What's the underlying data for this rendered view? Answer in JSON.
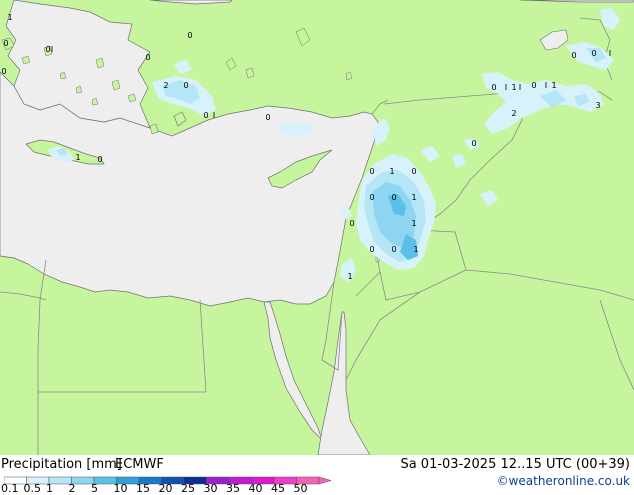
{
  "header": {
    "title": "Precipitation [mm]",
    "model": "ECMWF",
    "valid_time": "Sa 01-03-2025 12..15 UTC (00+39)",
    "credit": "©weatheronline.co.uk"
  },
  "legend": {
    "ticks": [
      "0.1",
      "0.5",
      "1",
      "2",
      "5",
      "10",
      "15",
      "20",
      "25",
      "30",
      "35",
      "40",
      "45",
      "50"
    ],
    "colors": [
      "#f7fcff",
      "#d8f2fb",
      "#b4e6f7",
      "#8ed5f1",
      "#5ac0e8",
      "#2fa2dd",
      "#1a78d0",
      "#1150b4",
      "#0b2e95",
      "#9c1fd0",
      "#c21ad8",
      "#e017d2",
      "#f03dc6",
      "#f660bc"
    ]
  },
  "map": {
    "colors": {
      "land": "#c6f59d",
      "sea": "#eeeeee",
      "border": "#8a8a8a",
      "coast": "#707070"
    },
    "labels": [
      {
        "text": "1"
      },
      {
        "text": "0"
      },
      {
        "text": "0"
      },
      {
        "text": "0"
      },
      {
        "text": "0"
      },
      {
        "text": "2"
      },
      {
        "text": "0"
      },
      {
        "text": "0"
      },
      {
        "text": "0"
      },
      {
        "text": "0"
      },
      {
        "text": "1"
      },
      {
        "text": "0"
      },
      {
        "text": "0"
      },
      {
        "text": "1"
      },
      {
        "text": "0"
      },
      {
        "text": "0"
      },
      {
        "text": "0"
      },
      {
        "text": "1"
      },
      {
        "text": "0"
      },
      {
        "text": "1"
      },
      {
        "text": "0"
      },
      {
        "text": "0"
      },
      {
        "text": "1"
      },
      {
        "text": "1"
      },
      {
        "text": "0"
      },
      {
        "text": "2"
      },
      {
        "text": "0"
      },
      {
        "text": "1"
      },
      {
        "text": "0"
      },
      {
        "text": "1"
      },
      {
        "text": "0"
      },
      {
        "text": "0"
      },
      {
        "text": "3"
      },
      {
        "text": "1"
      }
    ]
  }
}
